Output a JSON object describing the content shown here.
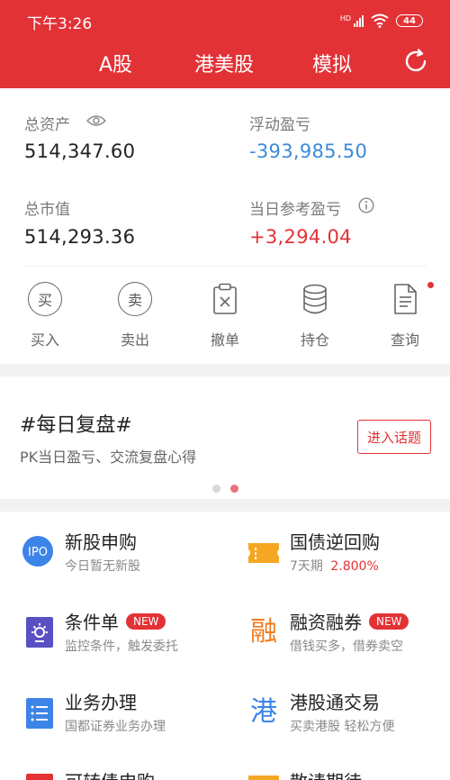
{
  "status_bar": {
    "time": "下午3:26",
    "signal_label": "HD",
    "battery": "44"
  },
  "header": {
    "tabs": [
      {
        "label": "A股"
      },
      {
        "label": "港美股"
      },
      {
        "label": "模拟"
      }
    ],
    "brand_color": "#e33236"
  },
  "assets": {
    "total_assets": {
      "label": "总资产",
      "value": "514,347.60"
    },
    "floating_pl": {
      "label": "浮动盈亏",
      "value": "-393,985.50"
    },
    "market_value": {
      "label": "总市值",
      "value": "514,293.36"
    },
    "daily_pl": {
      "label": "当日参考盈亏",
      "value": "+3,294.04"
    }
  },
  "actions": [
    {
      "label": "买入",
      "glyph": "买",
      "icon": "buy-icon"
    },
    {
      "label": "卖出",
      "glyph": "卖",
      "icon": "sell-icon"
    },
    {
      "label": "撤单",
      "icon": "cancel-order-icon"
    },
    {
      "label": "持仓",
      "icon": "holdings-icon"
    },
    {
      "label": "查询",
      "icon": "query-icon"
    }
  ],
  "topic": {
    "title": "#每日复盘#",
    "subtitle": "PK当日盈亏、交流复盘心得",
    "button": "进入话题"
  },
  "services": [
    {
      "title": "新股申购",
      "subtitle": "今日暂无新股",
      "icon": "ipo-icon",
      "icon_text": "IPO"
    },
    {
      "title": "国债逆回购",
      "subtitle_prefix": "7天期",
      "subtitle_highlight": "2.800%",
      "icon": "ticket-icon"
    },
    {
      "title": "条件单",
      "badge": "NEW",
      "subtitle": "监控条件，触发委托",
      "icon": "condition-order-icon"
    },
    {
      "title": "融资融券",
      "badge": "NEW",
      "subtitle": "借钱买多，借券卖空",
      "icon": "margin-trading-icon",
      "icon_text": "融"
    },
    {
      "title": "业务办理",
      "subtitle": "国都证券业务办理",
      "icon": "business-icon"
    },
    {
      "title": "港股通交易",
      "subtitle": "买卖港股 轻松方便",
      "icon": "hk-connect-icon",
      "icon_text": "港"
    },
    {
      "title": "可转债申购",
      "icon": "convertible-bond-icon"
    },
    {
      "title": "散请期待",
      "icon": "coming-soon-icon"
    }
  ]
}
